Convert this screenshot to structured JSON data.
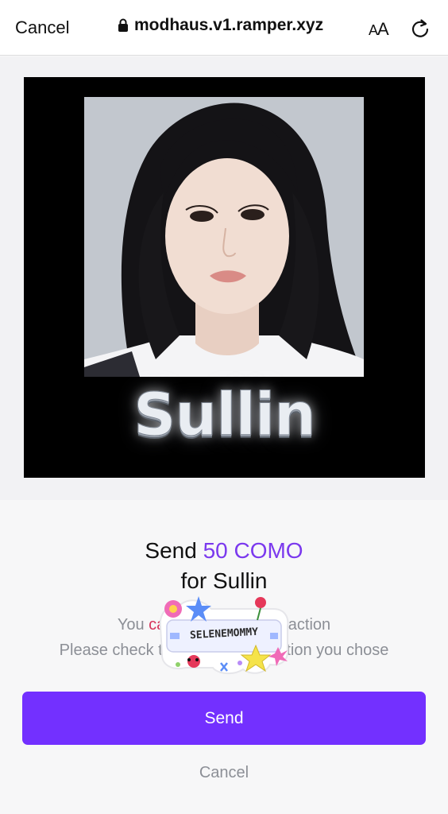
{
  "browser": {
    "cancel_label": "Cancel",
    "url": "modhaus.v1.ramper.xyz",
    "text_size_small": "A",
    "text_size_large": "A"
  },
  "card": {
    "name": "Sullin"
  },
  "sheet": {
    "send_prefix": "Send ",
    "amount": "50 COMO",
    "for_line": "for Sullin",
    "warning_line1_pre": "You ",
    "warning_line1_red": "ca",
    "warning_line1_post": "                        nsaction",
    "warning_line2_pre": "Please check t",
    "warning_line2_post": "                          ption you chose",
    "sticker_text": "SELENEMOMMY",
    "send_label": "Send",
    "cancel_label": "Cancel"
  },
  "colors": {
    "accent": "#7330ff",
    "amount": "#7b39ee",
    "danger": "#d6335a",
    "muted": "#8c8f96"
  },
  "icons": {
    "lock": "lock-icon",
    "reload": "reload-icon"
  }
}
